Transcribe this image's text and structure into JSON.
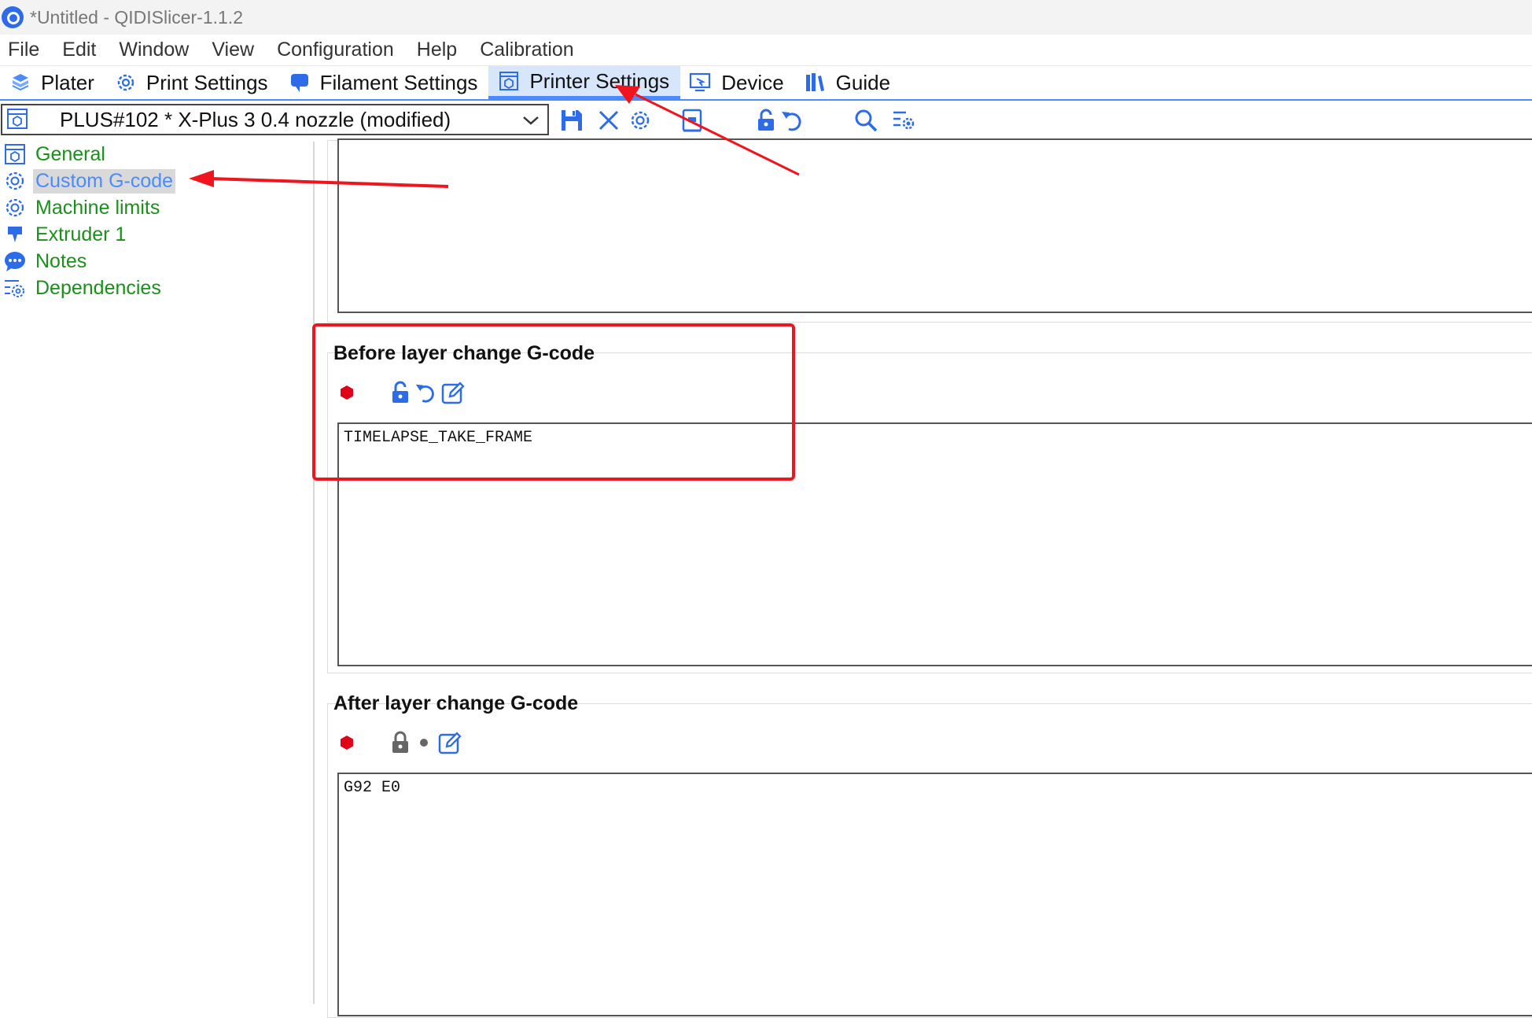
{
  "window": {
    "title": "*Untitled - QIDISlicer-1.1.2"
  },
  "menu": {
    "items": [
      "File",
      "Edit",
      "Window",
      "View",
      "Configuration",
      "Help",
      "Calibration"
    ]
  },
  "tabs": [
    {
      "label": "Plater",
      "icon": "plater-icon",
      "active": false
    },
    {
      "label": "Print Settings",
      "icon": "gear-icon",
      "active": false
    },
    {
      "label": "Filament Settings",
      "icon": "filament-icon",
      "active": false
    },
    {
      "label": "Printer Settings",
      "icon": "printer-icon",
      "active": true
    },
    {
      "label": "Device",
      "icon": "device-icon",
      "active": false
    },
    {
      "label": "Guide",
      "icon": "books-icon",
      "active": false
    }
  ],
  "preset": {
    "selected": "PLUS#102 * X-Plus 3 0.4 nozzle (modified)"
  },
  "sidebar": {
    "items": [
      {
        "label": "General",
        "icon": "printer-icon",
        "selected": false
      },
      {
        "label": "Custom G-code",
        "icon": "gear-icon",
        "selected": true
      },
      {
        "label": "Machine limits",
        "icon": "gear-icon",
        "selected": false
      },
      {
        "label": "Extruder 1",
        "icon": "extruder-icon",
        "selected": false
      },
      {
        "label": "Notes",
        "icon": "chat-bubble-icon",
        "selected": false
      },
      {
        "label": "Dependencies",
        "icon": "dependencies-icon",
        "selected": false
      }
    ]
  },
  "groups": {
    "before_layer": {
      "title": "Before layer change G-code",
      "code": "TIMELAPSE_TAKE_FRAME"
    },
    "after_layer": {
      "title": "After layer change G-code",
      "code": "G92 E0"
    }
  },
  "colors": {
    "accent": "#4a8bff",
    "sidebar_text": "#1b8f1b",
    "annotation_red": "#f0141e",
    "stop_icon": "#e0001a"
  }
}
